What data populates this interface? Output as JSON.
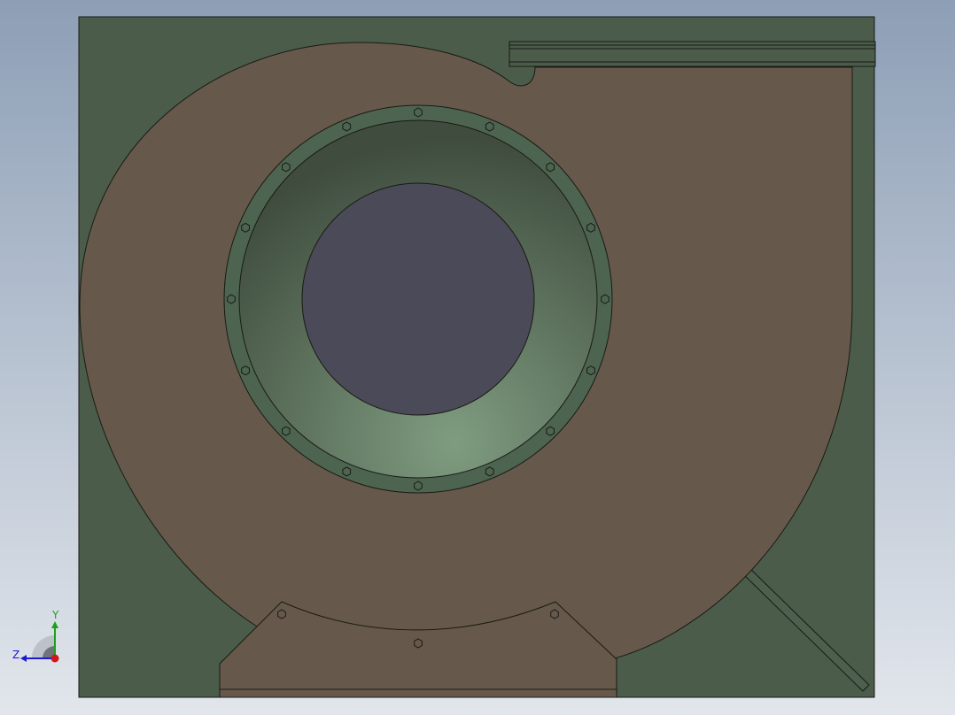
{
  "viewport": {
    "background_top": "#8d9fb6",
    "background_bottom": "#e2e6ec"
  },
  "part": {
    "frame_color": "#4b5c4b",
    "housing_color": "#66594b",
    "flange_color": "#4d6450",
    "cone_color_dark": "#3f4c3e",
    "cone_color_light": "#7f9c80",
    "inlet_opening_color": "#4b4a58",
    "edge_color": "#1a1a14",
    "bolt_holes_on_flange": 16,
    "bolt_holes_on_base": 3
  },
  "triad": {
    "y_label": "Y",
    "z_label": "Z",
    "y_color": "#1ca01c",
    "z_color": "#1a1ad0",
    "x_color": "#d01818"
  }
}
